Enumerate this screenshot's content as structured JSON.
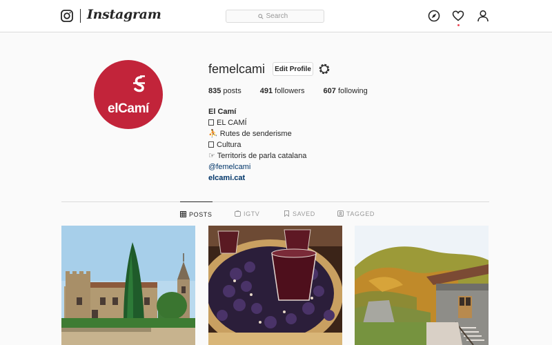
{
  "nav": {
    "wordmark": "Instagram",
    "search_placeholder": "Search",
    "icons": [
      "instagram-logo-icon",
      "search-icon",
      "compass-icon",
      "heart-icon",
      "profile-icon"
    ]
  },
  "profile": {
    "avatar_text": "elCamí",
    "username": "femelcami",
    "edit_label": "Edit Profile",
    "stats": [
      {
        "count": "835",
        "label": "posts"
      },
      {
        "count": "491",
        "label": "followers"
      },
      {
        "count": "607",
        "label": "following"
      }
    ],
    "bio": {
      "name": "El Camí",
      "lines": [
        "EL CAMÍ",
        "Rutes de senderisme",
        "Cultura",
        "Territoris de parla catalana"
      ],
      "mention": "@femelcami",
      "website": "elcami.cat"
    }
  },
  "tabs": [
    {
      "label": "POSTS",
      "icon": "grid-icon",
      "active": true
    },
    {
      "label": "IGTV",
      "icon": "igtv-icon",
      "active": false
    },
    {
      "label": "SAVED",
      "icon": "bookmark-icon",
      "active": false
    },
    {
      "label": "TAGGED",
      "icon": "tag-icon",
      "active": false
    }
  ],
  "colors": {
    "brand_red": "#c2243a",
    "link": "#003569",
    "notification": "#ed4956"
  }
}
